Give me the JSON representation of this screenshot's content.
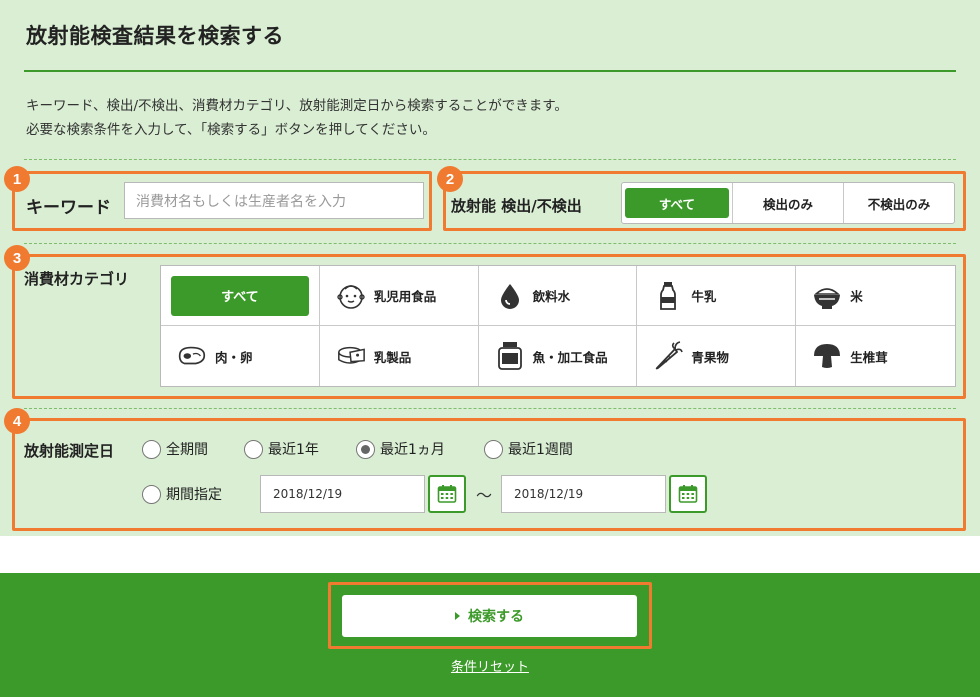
{
  "page": {
    "title": "放射能検査結果を検索する",
    "description_line1": "キーワード、検出/不検出、消費材カテゴリ、放射能測定日から検索することができます。",
    "description_line2": "必要な検索条件を入力して、「検索する」ボタンを押してください。"
  },
  "badges": [
    "1",
    "2",
    "3",
    "4"
  ],
  "keyword": {
    "label": "キーワード",
    "placeholder": "消費材名もしくは生産者名を入力"
  },
  "detection": {
    "label": "放射能 検出/不検出",
    "options": [
      "すべて",
      "検出のみ",
      "不検出のみ"
    ],
    "selected": "すべて"
  },
  "category": {
    "label": "消費材カテゴリ",
    "items": [
      {
        "label": "すべて",
        "icon": "all",
        "selected": true
      },
      {
        "label": "乳児用食品",
        "icon": "baby-icon"
      },
      {
        "label": "飲料水",
        "icon": "water-drop-icon"
      },
      {
        "label": "牛乳",
        "icon": "milk-bottle-icon"
      },
      {
        "label": "米",
        "icon": "rice-bowl-icon"
      },
      {
        "label": "肉・卵",
        "icon": "meat-icon"
      },
      {
        "label": "乳製品",
        "icon": "cheese-icon"
      },
      {
        "label": "魚・加工食品",
        "icon": "jar-icon"
      },
      {
        "label": "青果物",
        "icon": "carrot-icon"
      },
      {
        "label": "生椎茸",
        "icon": "mushroom-icon"
      }
    ]
  },
  "date": {
    "label": "放射能測定日",
    "options": [
      "全期間",
      "最近1年",
      "最近1ヵ月",
      "最近1週間",
      "期間指定"
    ],
    "selected": "最近1ヵ月",
    "from": "2018/12/19",
    "to": "2018/12/19",
    "separator": "〜"
  },
  "actions": {
    "search_label": "検索する",
    "reset_label": "条件リセット"
  },
  "colors": {
    "accent": "#3c9a2a",
    "highlight": "#f07a30",
    "panel_bg": "#d9eed3"
  }
}
